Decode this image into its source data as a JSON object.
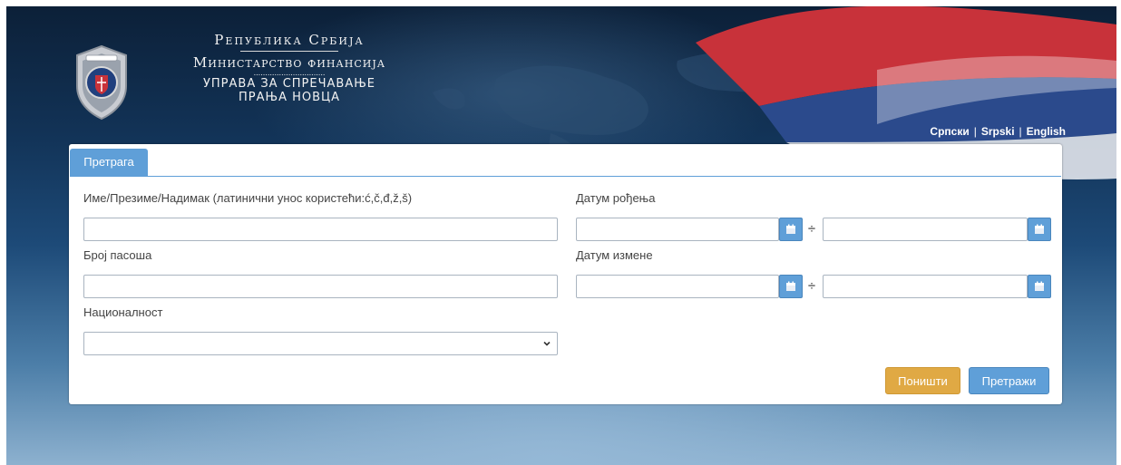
{
  "header": {
    "line1": "Република Србија",
    "line2": "Министарство финансија",
    "dots": "...............................",
    "line3": "УПРАВА ЗА СПРЕЧАВАЊЕ",
    "line4": "ПРАЊА НОВЦА",
    "emblem_icon": "police-badge-emblem"
  },
  "languages": {
    "cyrillic": "Српски",
    "latin": "Srpski",
    "english": "English",
    "separator": "|"
  },
  "search_form": {
    "tab_label": "Претрага",
    "name_label": "Име/Презиме/Надимак (латинични унос користећи:ć,č,đ,ž,š)",
    "name_value": "",
    "passport_label": "Број пасоша",
    "passport_value": "",
    "nationality_label": "Националност",
    "nationality_value": "",
    "birth_date_label": "Датум рођења",
    "change_date_label": "Датум измене",
    "range_separator": "÷",
    "calendar_icon": "calendar-icon",
    "reset_button": "Поништи",
    "search_button": "Претражи"
  },
  "colors": {
    "primary": "#5f9fd8",
    "warning": "#e0a944",
    "flag_red": "#c8323a",
    "flag_blue": "#2b4a8c",
    "flag_white": "#eef0f4"
  }
}
